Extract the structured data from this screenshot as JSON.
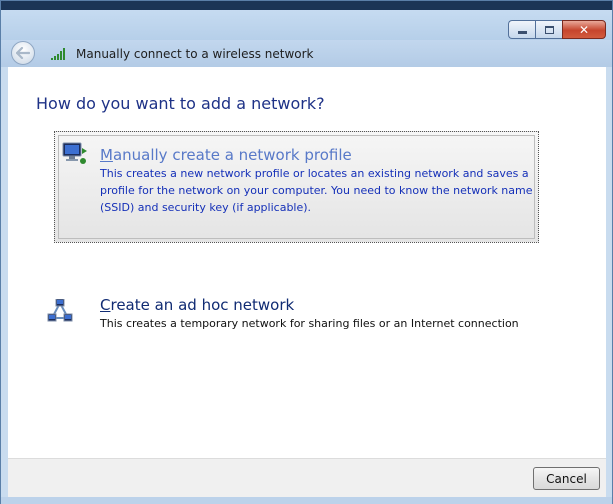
{
  "window": {
    "caption_buttons": {
      "minimize_icon": "minimize-icon",
      "maximize_icon": "maximize-icon",
      "close_glyph": "✕"
    }
  },
  "navbar": {
    "back_icon": "back-arrow-icon",
    "title_icon": "wireless-signal-icon",
    "title": "Manually connect to a wireless network"
  },
  "main": {
    "heading": "How do you want to add a network?",
    "options": [
      {
        "accel": "M",
        "title_rest": "anually create a network profile",
        "description": "This creates a new network profile or locates an existing network and saves a profile for the network on your computer. You need to know the network name (SSID) and security key (if applicable).",
        "icon": "network-profile-icon",
        "selected": true
      },
      {
        "accel": "C",
        "title_rest": "reate an ad hoc network",
        "description": "This creates a temporary network for sharing files or an Internet connection",
        "icon": "ad-hoc-network-icon",
        "selected": false
      }
    ]
  },
  "footer": {
    "cancel_label": "Cancel"
  },
  "colors": {
    "heading": "#1e3287",
    "link_highlight": "#5879c8",
    "link": "#102b73",
    "selected_desc": "#1530b8"
  }
}
